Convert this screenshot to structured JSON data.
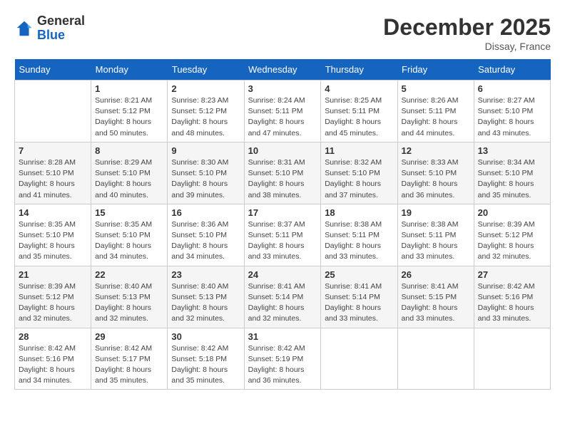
{
  "logo": {
    "general": "General",
    "blue": "Blue"
  },
  "title": "December 2025",
  "subtitle": "Dissay, France",
  "headers": [
    "Sunday",
    "Monday",
    "Tuesday",
    "Wednesday",
    "Thursday",
    "Friday",
    "Saturday"
  ],
  "weeks": [
    [
      {
        "day": "",
        "info": ""
      },
      {
        "day": "1",
        "info": "Sunrise: 8:21 AM\nSunset: 5:12 PM\nDaylight: 8 hours\nand 50 minutes."
      },
      {
        "day": "2",
        "info": "Sunrise: 8:23 AM\nSunset: 5:12 PM\nDaylight: 8 hours\nand 48 minutes."
      },
      {
        "day": "3",
        "info": "Sunrise: 8:24 AM\nSunset: 5:11 PM\nDaylight: 8 hours\nand 47 minutes."
      },
      {
        "day": "4",
        "info": "Sunrise: 8:25 AM\nSunset: 5:11 PM\nDaylight: 8 hours\nand 45 minutes."
      },
      {
        "day": "5",
        "info": "Sunrise: 8:26 AM\nSunset: 5:11 PM\nDaylight: 8 hours\nand 44 minutes."
      },
      {
        "day": "6",
        "info": "Sunrise: 8:27 AM\nSunset: 5:10 PM\nDaylight: 8 hours\nand 43 minutes."
      }
    ],
    [
      {
        "day": "7",
        "info": "Sunrise: 8:28 AM\nSunset: 5:10 PM\nDaylight: 8 hours\nand 41 minutes."
      },
      {
        "day": "8",
        "info": "Sunrise: 8:29 AM\nSunset: 5:10 PM\nDaylight: 8 hours\nand 40 minutes."
      },
      {
        "day": "9",
        "info": "Sunrise: 8:30 AM\nSunset: 5:10 PM\nDaylight: 8 hours\nand 39 minutes."
      },
      {
        "day": "10",
        "info": "Sunrise: 8:31 AM\nSunset: 5:10 PM\nDaylight: 8 hours\nand 38 minutes."
      },
      {
        "day": "11",
        "info": "Sunrise: 8:32 AM\nSunset: 5:10 PM\nDaylight: 8 hours\nand 37 minutes."
      },
      {
        "day": "12",
        "info": "Sunrise: 8:33 AM\nSunset: 5:10 PM\nDaylight: 8 hours\nand 36 minutes."
      },
      {
        "day": "13",
        "info": "Sunrise: 8:34 AM\nSunset: 5:10 PM\nDaylight: 8 hours\nand 35 minutes."
      }
    ],
    [
      {
        "day": "14",
        "info": "Sunrise: 8:35 AM\nSunset: 5:10 PM\nDaylight: 8 hours\nand 35 minutes."
      },
      {
        "day": "15",
        "info": "Sunrise: 8:35 AM\nSunset: 5:10 PM\nDaylight: 8 hours\nand 34 minutes."
      },
      {
        "day": "16",
        "info": "Sunrise: 8:36 AM\nSunset: 5:10 PM\nDaylight: 8 hours\nand 34 minutes."
      },
      {
        "day": "17",
        "info": "Sunrise: 8:37 AM\nSunset: 5:11 PM\nDaylight: 8 hours\nand 33 minutes."
      },
      {
        "day": "18",
        "info": "Sunrise: 8:38 AM\nSunset: 5:11 PM\nDaylight: 8 hours\nand 33 minutes."
      },
      {
        "day": "19",
        "info": "Sunrise: 8:38 AM\nSunset: 5:11 PM\nDaylight: 8 hours\nand 33 minutes."
      },
      {
        "day": "20",
        "info": "Sunrise: 8:39 AM\nSunset: 5:12 PM\nDaylight: 8 hours\nand 32 minutes."
      }
    ],
    [
      {
        "day": "21",
        "info": "Sunrise: 8:39 AM\nSunset: 5:12 PM\nDaylight: 8 hours\nand 32 minutes."
      },
      {
        "day": "22",
        "info": "Sunrise: 8:40 AM\nSunset: 5:13 PM\nDaylight: 8 hours\nand 32 minutes."
      },
      {
        "day": "23",
        "info": "Sunrise: 8:40 AM\nSunset: 5:13 PM\nDaylight: 8 hours\nand 32 minutes."
      },
      {
        "day": "24",
        "info": "Sunrise: 8:41 AM\nSunset: 5:14 PM\nDaylight: 8 hours\nand 32 minutes."
      },
      {
        "day": "25",
        "info": "Sunrise: 8:41 AM\nSunset: 5:14 PM\nDaylight: 8 hours\nand 33 minutes."
      },
      {
        "day": "26",
        "info": "Sunrise: 8:41 AM\nSunset: 5:15 PM\nDaylight: 8 hours\nand 33 minutes."
      },
      {
        "day": "27",
        "info": "Sunrise: 8:42 AM\nSunset: 5:16 PM\nDaylight: 8 hours\nand 33 minutes."
      }
    ],
    [
      {
        "day": "28",
        "info": "Sunrise: 8:42 AM\nSunset: 5:16 PM\nDaylight: 8 hours\nand 34 minutes."
      },
      {
        "day": "29",
        "info": "Sunrise: 8:42 AM\nSunset: 5:17 PM\nDaylight: 8 hours\nand 35 minutes."
      },
      {
        "day": "30",
        "info": "Sunrise: 8:42 AM\nSunset: 5:18 PM\nDaylight: 8 hours\nand 35 minutes."
      },
      {
        "day": "31",
        "info": "Sunrise: 8:42 AM\nSunset: 5:19 PM\nDaylight: 8 hours\nand 36 minutes."
      },
      {
        "day": "",
        "info": ""
      },
      {
        "day": "",
        "info": ""
      },
      {
        "day": "",
        "info": ""
      }
    ]
  ]
}
